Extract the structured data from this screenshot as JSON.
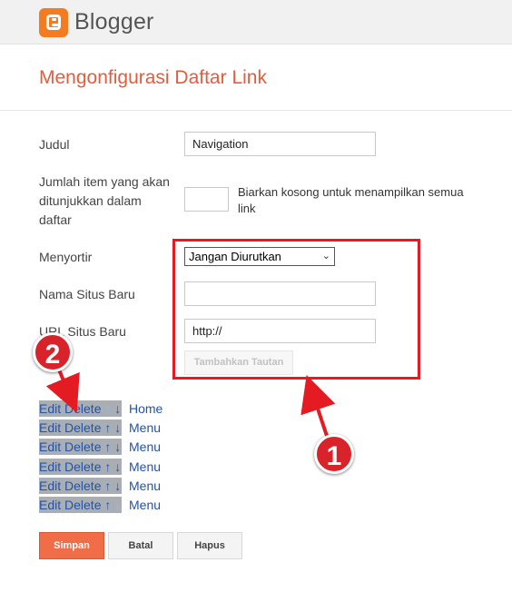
{
  "app": {
    "brand": "Blogger"
  },
  "page": {
    "title": "Mengonfigurasi Daftar Link"
  },
  "form": {
    "title_label": "Judul",
    "title_value": "Navigation",
    "count_label_1": "Jumlah item yang akan",
    "count_label_2": "ditunjukkan dalam",
    "count_label_3": "daftar",
    "count_value": "",
    "count_hint": "Biarkan kosong untuk menampilkan semua link",
    "sort_label": "Menyortir",
    "sort_value": "Jangan Diurutkan",
    "new_name_label": "Nama Situs Baru",
    "new_name_value": "",
    "new_url_label": "URL Situs Baru",
    "new_url_value": "http://",
    "add_button": "Tambahkan Tautan"
  },
  "annotations": {
    "marker_1": "1",
    "marker_2": "2"
  },
  "links": [
    {
      "edit": "Edit",
      "delete": "Delete",
      "up": "↑",
      "down": "↓",
      "name": "Home"
    },
    {
      "edit": "Edit",
      "delete": "Delete",
      "up": "↑",
      "down": "↓",
      "name": "Menu"
    },
    {
      "edit": "Edit",
      "delete": "Delete",
      "up": "↑",
      "down": "↓",
      "name": "Menu"
    },
    {
      "edit": "Edit",
      "delete": "Delete",
      "up": "↑",
      "down": "↓",
      "name": "Menu"
    },
    {
      "edit": "Edit",
      "delete": "Delete",
      "up": "↑",
      "down": "↓",
      "name": "Menu"
    },
    {
      "edit": "Edit",
      "delete": "Delete",
      "up": "↑",
      "down": "↓",
      "name": "Menu"
    }
  ],
  "buttons": {
    "save": "Simpan",
    "cancel": "Batal",
    "delete": "Hapus"
  },
  "colors": {
    "accent": "#e35d3d",
    "logo": "#f47b20",
    "highlight_box": "#e51b23",
    "link": "#2253a8"
  }
}
